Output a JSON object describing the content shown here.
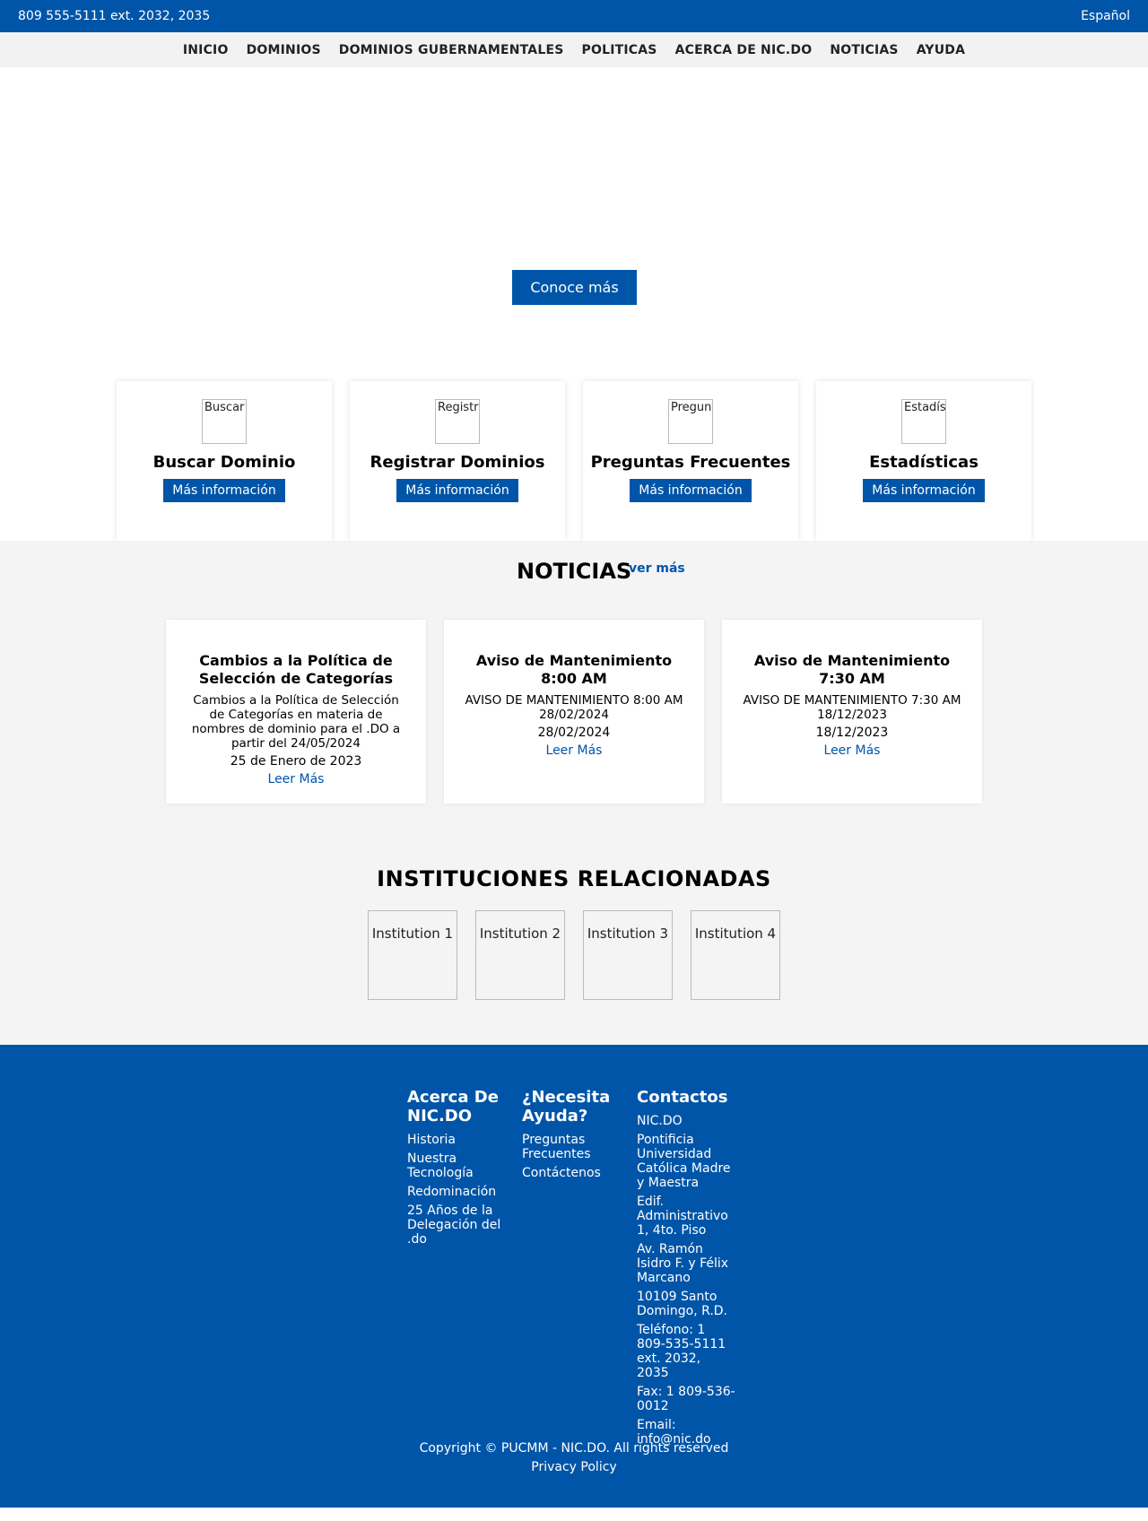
{
  "topbar": {
    "phone": "809 555-5111 ext. 2032, 2035",
    "language": "Español"
  },
  "nav": [
    "INICIO",
    "DOMINIOS",
    "DOMINIOS GUBERNAMENTALES",
    "POLITICAS",
    "ACERCA DE NIC.DO",
    "NOTICIAS",
    "AYUDA"
  ],
  "hero": {
    "button": "Conoce más"
  },
  "cards": [
    {
      "alt": "Buscar Dominio",
      "title": "Buscar Dominio",
      "button": "Más información"
    },
    {
      "alt": "Registrar Dominios",
      "title": "Registrar Dominios",
      "button": "Más información"
    },
    {
      "alt": "Preguntas Frecuentes",
      "title": "Preguntas Frecuentes",
      "button": "Más información"
    },
    {
      "alt": "Estadísticas",
      "title": "Estadísticas",
      "button": "Más información"
    }
  ],
  "news": {
    "heading": "NOTICIAS",
    "more": "ver más",
    "items": [
      {
        "title": "Cambios a la Política de Selección de Categorías",
        "summary": "Cambios a la Política de Selección de Categorías en materia de nombres de dominio para el .DO a partir del 24/05/2024",
        "date": "25 de Enero de 2023",
        "link": "Leer Más"
      },
      {
        "title": "Aviso de Mantenimiento 8:00 AM",
        "summary": "AVISO DE MANTENIMIENTO 8:00 AM 28/02/2024",
        "date": "28/02/2024",
        "link": "Leer Más"
      },
      {
        "title": "Aviso de Mantenimiento 7:30 AM",
        "summary": "AVISO DE MANTENIMIENTO 7:30 AM 18/12/2023",
        "date": "18/12/2023",
        "link": "Leer Más"
      }
    ]
  },
  "institutions": {
    "heading": "INSTITUCIONES RELACIONADAS",
    "items": [
      "Institution 1",
      "Institution 2",
      "Institution 3",
      "Institution 4"
    ]
  },
  "footer": {
    "about": {
      "title": "Acerca De NIC.DO",
      "links": [
        "Historia",
        "Nuestra Tecnología",
        "Redominación",
        "25 Años de la Delegación del .do"
      ]
    },
    "help": {
      "title": "¿Necesita Ayuda?",
      "links": [
        "Preguntas Frecuentes",
        "Contáctenos"
      ]
    },
    "contacts": {
      "title": "Contactos",
      "lines": [
        "NIC.DO",
        "Pontificia Universidad Católica Madre y Maestra",
        "Edif. Administrativo 1, 4to. Piso",
        "Av. Ramón Isidro F. y Félix Marcano",
        "10109 Santo Domingo, R.D.",
        "Teléfono: 1 809-535-5111 ext. 2032, 2035",
        "Fax: 1 809-536-0012",
        "Email: info@nic.do"
      ]
    },
    "copyright": "Copyright © PUCMM - NIC.DO. All rights reserved",
    "privacy": "Privacy Policy"
  }
}
